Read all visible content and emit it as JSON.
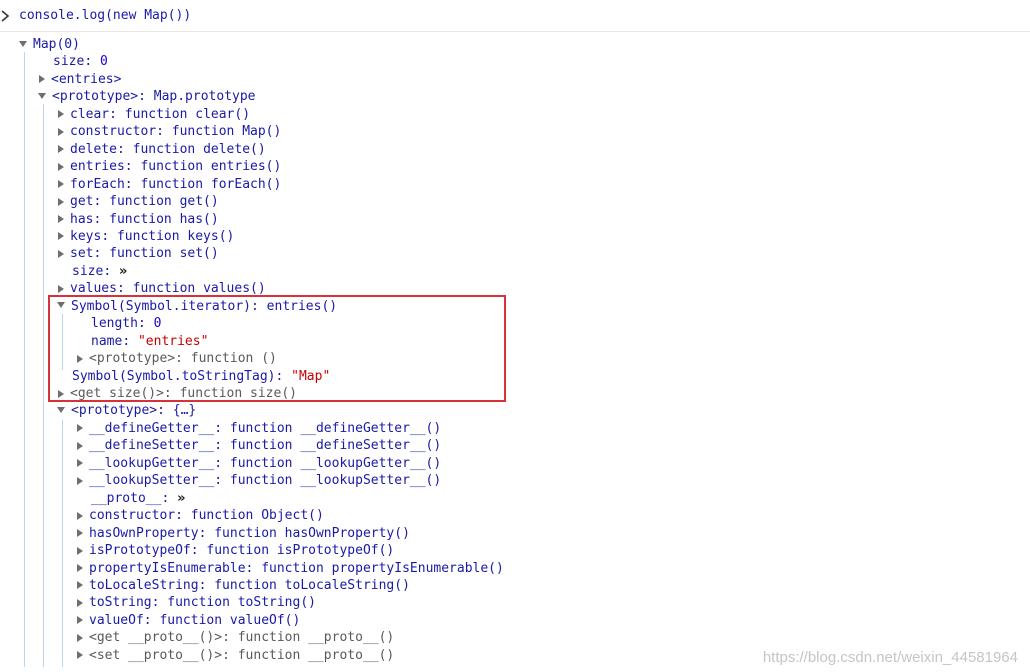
{
  "console": {
    "command": "console.log(new Map())"
  },
  "lines": [
    {
      "key": "Map(0)",
      "sep": "",
      "val": "",
      "tri": "d",
      "kind": "plain"
    },
    {
      "key": "size",
      "sep": ": ",
      "val": "0",
      "tri": "",
      "kind": "num"
    },
    {
      "key": "<entries>",
      "sep": "",
      "val": "",
      "tri": "r",
      "kind": "plain"
    },
    {
      "key": "<prototype>",
      "sep": ": ",
      "val": "Map.prototype",
      "tri": "d",
      "kind": "plain"
    },
    {
      "key": "clear",
      "sep": ": ",
      "val": "function clear()",
      "tri": "r",
      "kind": "plain"
    },
    {
      "key": "constructor",
      "sep": ": ",
      "val": "function Map()",
      "tri": "r",
      "kind": "plain"
    },
    {
      "key": "delete",
      "sep": ": ",
      "val": "function delete()",
      "tri": "r",
      "kind": "plain"
    },
    {
      "key": "entries",
      "sep": ": ",
      "val": "function entries()",
      "tri": "r",
      "kind": "plain"
    },
    {
      "key": "forEach",
      "sep": ": ",
      "val": "function forEach()",
      "tri": "r",
      "kind": "plain"
    },
    {
      "key": "get",
      "sep": ": ",
      "val": "function get()",
      "tri": "r",
      "kind": "plain"
    },
    {
      "key": "has",
      "sep": ": ",
      "val": "function has()",
      "tri": "r",
      "kind": "plain"
    },
    {
      "key": "keys",
      "sep": ": ",
      "val": "function keys()",
      "tri": "r",
      "kind": "plain"
    },
    {
      "key": "set",
      "sep": ": ",
      "val": "function set()",
      "tri": "r",
      "kind": "plain"
    },
    {
      "key": "size",
      "sep": ": ",
      "val": "»",
      "tri": "",
      "kind": "dbl"
    },
    {
      "key": "values",
      "sep": ": ",
      "val": "function values()",
      "tri": "r",
      "kind": "plain"
    },
    {
      "key": "Symbol(Symbol.iterator)",
      "sep": ": ",
      "val": "entries()",
      "tri": "d",
      "kind": "plain"
    },
    {
      "key": "length",
      "sep": ": ",
      "val": "0",
      "tri": "",
      "kind": "num"
    },
    {
      "key": "name",
      "sep": ": ",
      "val": "\"entries\"",
      "tri": "",
      "kind": "str"
    },
    {
      "key": "<prototype>",
      "sep": ": ",
      "val": "function ()",
      "tri": "r",
      "kind": "gray"
    },
    {
      "key": "Symbol(Symbol.toStringTag)",
      "sep": ": ",
      "val": "\"Map\"",
      "tri": "",
      "kind": "str"
    },
    {
      "key": "<get size()>",
      "sep": ": ",
      "val": "function size()",
      "tri": "r",
      "kind": "gray"
    },
    {
      "key": "<prototype>",
      "sep": ": ",
      "val": "{…}",
      "tri": "d",
      "kind": "plain"
    },
    {
      "key": "__defineGetter__",
      "sep": ": ",
      "val": "function __defineGetter__()",
      "tri": "r",
      "kind": "plain"
    },
    {
      "key": "__defineSetter__",
      "sep": ": ",
      "val": "function __defineSetter__()",
      "tri": "r",
      "kind": "plain"
    },
    {
      "key": "__lookupGetter__",
      "sep": ": ",
      "val": "function __lookupGetter__()",
      "tri": "r",
      "kind": "plain"
    },
    {
      "key": "__lookupSetter__",
      "sep": ": ",
      "val": "function __lookupSetter__()",
      "tri": "r",
      "kind": "plain"
    },
    {
      "key": "__proto__",
      "sep": ": ",
      "val": "»",
      "tri": "",
      "kind": "dbl"
    },
    {
      "key": "constructor",
      "sep": ": ",
      "val": "function Object()",
      "tri": "r",
      "kind": "plain"
    },
    {
      "key": "hasOwnProperty",
      "sep": ": ",
      "val": "function hasOwnProperty()",
      "tri": "r",
      "kind": "plain"
    },
    {
      "key": "isPrototypeOf",
      "sep": ": ",
      "val": "function isPrototypeOf()",
      "tri": "r",
      "kind": "plain"
    },
    {
      "key": "propertyIsEnumerable",
      "sep": ": ",
      "val": "function propertyIsEnumerable()",
      "tri": "r",
      "kind": "plain"
    },
    {
      "key": "toLocaleString",
      "sep": ": ",
      "val": "function toLocaleString()",
      "tri": "r",
      "kind": "plain"
    },
    {
      "key": "toString",
      "sep": ": ",
      "val": "function toString()",
      "tri": "r",
      "kind": "plain"
    },
    {
      "key": "valueOf",
      "sep": ": ",
      "val": "function valueOf()",
      "tri": "r",
      "kind": "plain"
    },
    {
      "key": "<get __proto__()>",
      "sep": ": ",
      "val": "function __proto__()",
      "tri": "r",
      "kind": "gray"
    },
    {
      "key": "<set __proto__()>",
      "sep": ": ",
      "val": "function __proto__()",
      "tri": "r",
      "kind": "gray"
    }
  ],
  "watermark": "https://blog.csdn.net/weixin_44581964",
  "colors": {
    "key": "#1a1aa6",
    "number": "#1c00cf",
    "string": "#c80000",
    "highlight_border": "#d6323a"
  }
}
